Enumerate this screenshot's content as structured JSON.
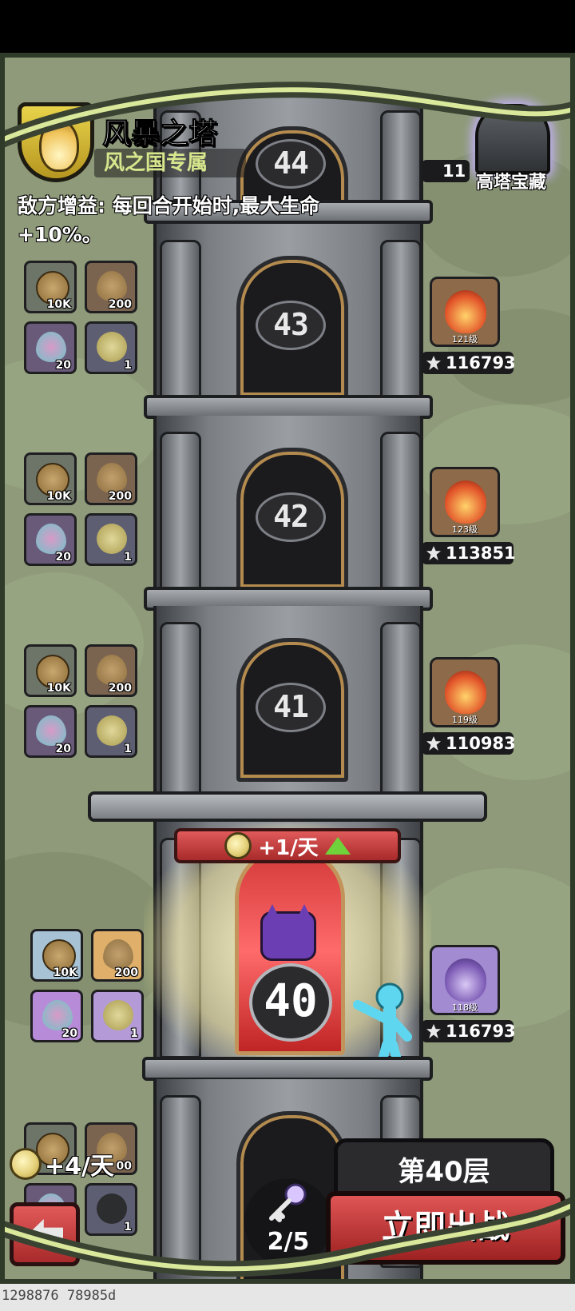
{
  "header": {
    "title": "风暴之塔",
    "subtitle": "风之国专属",
    "buff_text": "敌方增益: 每回合开始时,最大生命+10%。",
    "treasure_label": "高塔宝藏"
  },
  "floors": [
    {
      "number": "44",
      "enemy_power": "11"
    },
    {
      "number": "43",
      "enemy_level": "121级",
      "enemy_power": "116793",
      "rewards": [
        {
          "icon": "coin-icon",
          "amount": "10K"
        },
        {
          "icon": "heart-icon",
          "amount": "200"
        },
        {
          "icon": "pink-heart-icon",
          "amount": "20"
        },
        {
          "icon": "swirl-icon",
          "amount": "1"
        }
      ]
    },
    {
      "number": "42",
      "enemy_level": "123级",
      "enemy_power": "113851",
      "rewards": [
        {
          "icon": "coin-icon",
          "amount": "10K"
        },
        {
          "icon": "heart-icon",
          "amount": "200"
        },
        {
          "icon": "pink-heart-icon",
          "amount": "20"
        },
        {
          "icon": "swirl-icon",
          "amount": "1"
        }
      ]
    },
    {
      "number": "41",
      "enemy_level": "119级",
      "enemy_power": "110983",
      "rewards": [
        {
          "icon": "coin-icon",
          "amount": "10K"
        },
        {
          "icon": "heart-icon",
          "amount": "200"
        },
        {
          "icon": "pink-heart-icon",
          "amount": "20"
        },
        {
          "icon": "swirl-icon",
          "amount": "1"
        }
      ]
    }
  ],
  "current_floor": {
    "number": "40",
    "banner": "+1/天",
    "enemy_level": "118级",
    "enemy_power": "116793",
    "rewards": [
      {
        "icon": "coin-icon",
        "amount": "10K"
      },
      {
        "icon": "heart-icon",
        "amount": "200"
      },
      {
        "icon": "pink-heart-icon",
        "amount": "20"
      },
      {
        "icon": "swirl-icon",
        "amount": "1"
      }
    ]
  },
  "footer": {
    "daily_gain": "+4/天",
    "bottom_reward_amount": "1",
    "bottom_reward_amount_2": "00",
    "key_count": "2/5",
    "floor_label": "第40层",
    "fight_button": "立即出战"
  },
  "debug_text": "1298876 78985d",
  "colors": {
    "background": "#8e9a79",
    "accent_red": "#c83333",
    "title_green": "#d7e68c"
  }
}
